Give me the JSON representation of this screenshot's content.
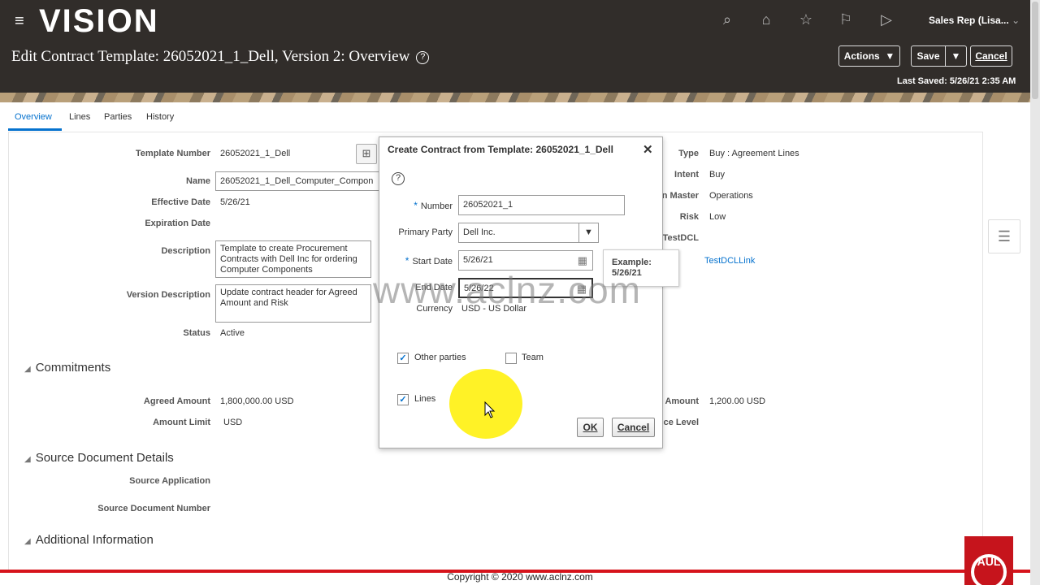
{
  "header": {
    "logo": "VISION",
    "page_title": "Edit Contract Template: 26052021_1_Dell, Version 2: Overview",
    "help_glyph": "?",
    "user": "Sales Rep (Lisa...",
    "actions_label": "Actions",
    "save_label": "Save",
    "cancel_label": "Cancel",
    "last_saved_label": "Last Saved:",
    "last_saved_value": "5/26/21 2:35 AM",
    "icons": [
      "search-icon",
      "home-icon",
      "star-icon",
      "flag-icon",
      "notifications-icon"
    ]
  },
  "tabs": [
    "Overview",
    "Lines",
    "Parties",
    "History"
  ],
  "form": {
    "template_number_label": "Template Number",
    "template_number": "26052021_1_Dell",
    "name_label": "Name",
    "name": "26052021_1_Dell_Computer_Compon",
    "effective_date_label": "Effective Date",
    "effective_date": "5/26/21",
    "expiration_date_label": "Expiration Date",
    "description_label": "Description",
    "description": "Template to create Procurement Contracts with Dell Inc for ordering Computer Components",
    "version_description_label": "Version Description",
    "version_description": "Update contract header for Agreed Amount and Risk",
    "status_label": "Status",
    "status": "Active",
    "type_label": "Type",
    "type": "Buy : Agreement Lines",
    "intent_label": "Intent",
    "intent": "Buy",
    "master_label": "n Master",
    "master": "Operations",
    "risk_label": "Risk",
    "risk": "Low",
    "testdcl_label": "TestDCL",
    "testdcl_link": "TestDCLLink"
  },
  "commitments": {
    "title": "Commitments",
    "agreed_amount_label": "Agreed Amount",
    "agreed_amount": "1,800,000.00",
    "agreed_currency": "USD",
    "amount_limit_label": "Amount Limit",
    "amount_limit": "USD",
    "right_amount_label": "Amount",
    "right_amount": "1,200.00",
    "right_currency": "USD",
    "right_level_label": "ce Level"
  },
  "source": {
    "title": "Source Document Details",
    "application_label": "Source Application",
    "doc_number_label": "Source Document Number"
  },
  "additional": {
    "title": "Additional Information"
  },
  "dialog": {
    "title": "Create Contract from Template: 26052021_1_Dell",
    "close": "✕",
    "number_label": "Number",
    "number_value": "26052021_1",
    "primary_party_label": "Primary Party",
    "primary_party_value": "Dell Inc.",
    "start_date_label": "Start Date",
    "start_date_value": "5/26/21",
    "end_date_label": "End Date",
    "end_date_value": "5/26/22",
    "currency_label": "Currency",
    "currency_value": "USD - US Dollar",
    "other_parties_label": "Other parties",
    "other_parties_checked": true,
    "team_label": "Team",
    "team_checked": false,
    "lines_label": "Lines",
    "lines_checked": true,
    "ok_label": "OK",
    "cancel_label": "Cancel",
    "required_mark": "*",
    "check_glyph": "✓"
  },
  "tooltip": {
    "line1": "Example:",
    "line2": "5/26/21"
  },
  "watermark": "www.aclnz.com",
  "footer": {
    "copyright": "Copyright © 2020 www.aclnz.com",
    "brand": "AUL"
  }
}
